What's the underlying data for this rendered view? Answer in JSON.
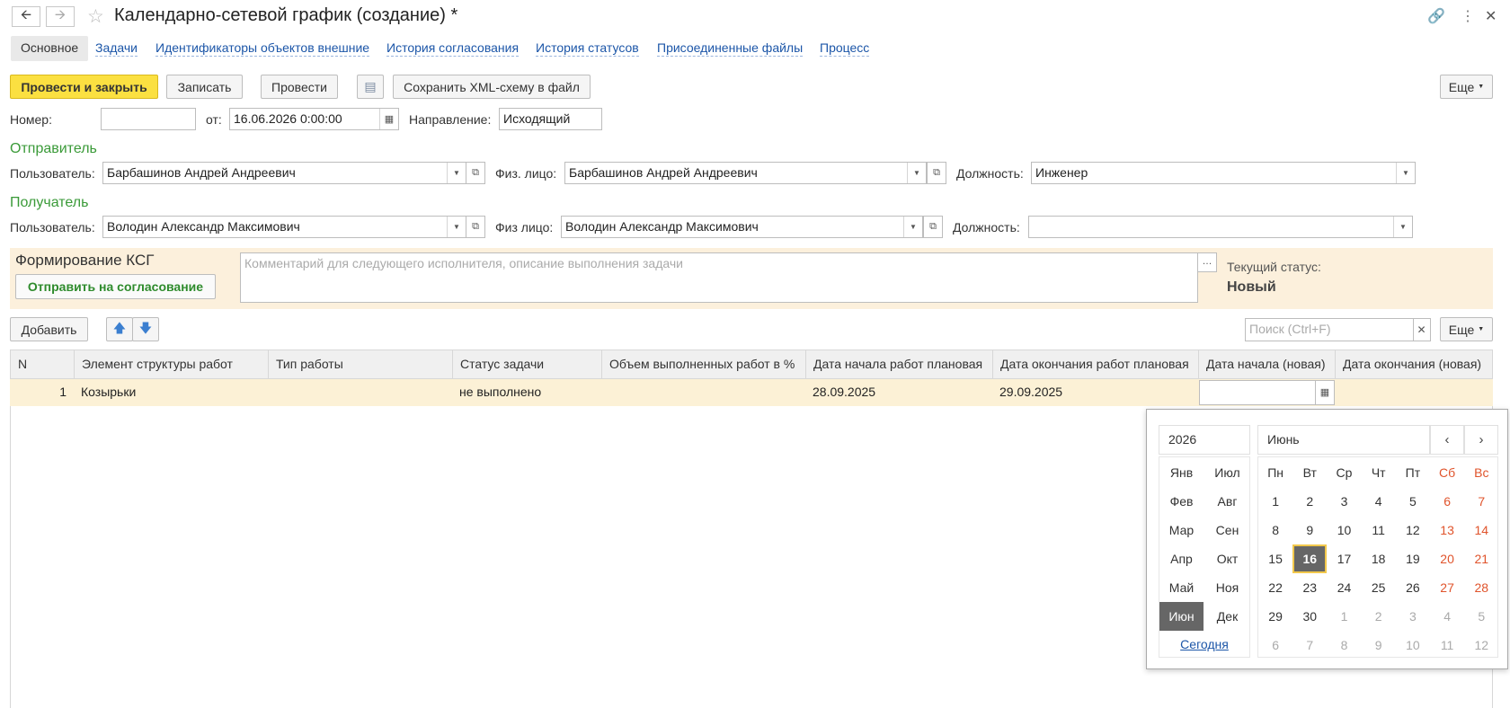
{
  "window": {
    "title": "Календарно-сетевой график (создание) *",
    "back_icon": "arrow-left-icon",
    "forward_icon": "arrow-right-icon"
  },
  "tabs": [
    {
      "label": "Основное",
      "active": true
    },
    {
      "label": "Задачи"
    },
    {
      "label": "Идентификаторы объектов внешние"
    },
    {
      "label": "История согласования"
    },
    {
      "label": "История статусов"
    },
    {
      "label": "Присоединенные файлы"
    },
    {
      "label": "Процесс"
    }
  ],
  "toolbar": {
    "post_close": "Провести и закрыть",
    "save": "Записать",
    "post": "Провести",
    "save_xml": "Сохранить XML-схему в файл",
    "more": "Еще"
  },
  "header": {
    "number_label": "Номер:",
    "number_value": "",
    "date_label": "от:",
    "date_value": "16.06.2026  0:00:00",
    "direction_label": "Направление:",
    "direction_value": "Исходящий"
  },
  "sender": {
    "section": "Отправитель",
    "user_label": "Пользователь:",
    "user_value": "Барбашинов Андрей Андреевич",
    "person_label": "Физ. лицо:",
    "person_value": "Барбашинов Андрей Андреевич",
    "position_label": "Должность:",
    "position_value": "Инженер"
  },
  "receiver": {
    "section": "Получатель",
    "user_label": "Пользователь:",
    "user_value": "Володин Александр Максимович",
    "person_label": "Физ лицо:",
    "person_value": "Володин Александр Максимович",
    "position_label": "Должность:",
    "position_value": ""
  },
  "ksg": {
    "title": "Формирование КСГ",
    "send_button": "Отправить на согласование",
    "comment_placeholder": "Комментарий для следующего исполнителя, описание выполнения задачи",
    "status_label": "Текущий статус:",
    "status_value": "Новый"
  },
  "table_toolbar": {
    "add": "Добавить",
    "search_placeholder": "Поиск (Ctrl+F)",
    "more": "Еще"
  },
  "table": {
    "columns": [
      "N",
      "Элемент структуры работ",
      "Тип работы",
      "Статус задачи",
      "Объем выполненных работ в %",
      "Дата начала работ плановая",
      "Дата окончания работ плановая",
      "Дата начала (новая)",
      "Дата окончания (новая)"
    ],
    "rows": [
      {
        "n": "1",
        "element": "Козырьки",
        "type": "",
        "status": "не выполнено",
        "volume": "",
        "start_plan": "28.09.2025",
        "end_plan": "29.09.2025",
        "start_new": " .  .",
        "end_new": ""
      }
    ]
  },
  "calendar": {
    "year": "2026",
    "month": "Июнь",
    "months_left": [
      "Янв",
      "Фев",
      "Мар",
      "Апр",
      "Май",
      "Июн"
    ],
    "months_right": [
      "Июл",
      "Авг",
      "Сен",
      "Окт",
      "Ноя",
      "Дек"
    ],
    "selected_month": "Июн",
    "weekdays": [
      "Пн",
      "Вт",
      "Ср",
      "Чт",
      "Пт",
      "Сб",
      "Вс"
    ],
    "weeks": [
      [
        "1",
        "2",
        "3",
        "4",
        "5",
        "6",
        "7"
      ],
      [
        "8",
        "9",
        "10",
        "11",
        "12",
        "13",
        "14"
      ],
      [
        "15",
        "16",
        "17",
        "18",
        "19",
        "20",
        "21"
      ],
      [
        "22",
        "23",
        "24",
        "25",
        "26",
        "27",
        "28"
      ],
      [
        "29",
        "30",
        "1",
        "2",
        "3",
        "4",
        "5"
      ],
      [
        "6",
        "7",
        "8",
        "9",
        "10",
        "11",
        "12"
      ]
    ],
    "selected_day": "16",
    "today_label": "Сегодня",
    "colors": {
      "weekend": "#e0542c",
      "other_month": "#aaaaaa",
      "selected_bg": "#666666",
      "accent": "#f2c84b"
    }
  }
}
